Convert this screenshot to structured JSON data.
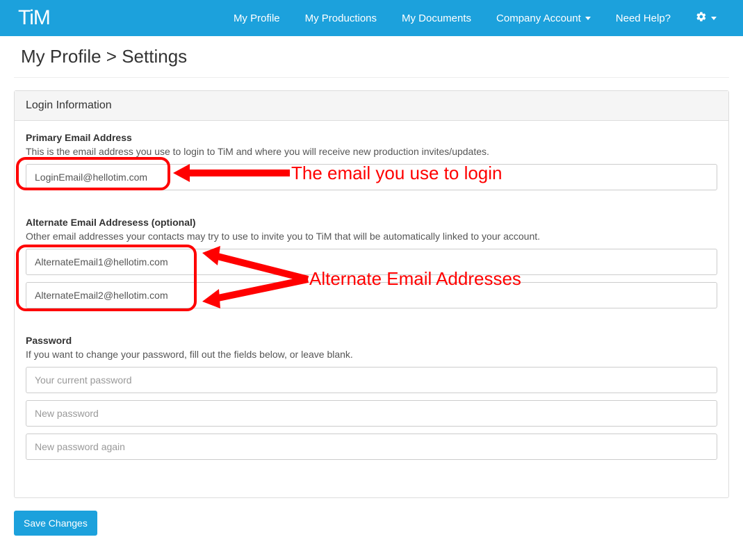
{
  "nav": {
    "logo": "TiM",
    "links": {
      "profile": "My Profile",
      "productions": "My Productions",
      "documents": "My Documents",
      "company": "Company Account",
      "help": "Need Help?"
    }
  },
  "breadcrumb": "My Profile > Settings",
  "panel": {
    "title": "Login Information",
    "primary": {
      "label": "Primary Email Address",
      "help": "This is the email address you use to login to TiM and where you will receive new production invites/updates.",
      "value": "LoginEmail@hellotim.com"
    },
    "alternate": {
      "label": "Alternate Email Addresess (optional)",
      "help": "Other email addresses your contacts may try to use to invite you to TiM that will be automatically linked to your account.",
      "value1": "AlternateEmail1@hellotim.com",
      "value2": "AlternateEmail2@hellotim.com"
    },
    "password": {
      "label": "Password",
      "help": "If you want to change your password, fill out the fields below, or leave blank.",
      "placeholder_current": "Your current password",
      "placeholder_new": "New password",
      "placeholder_again": "New password again"
    }
  },
  "buttons": {
    "save": "Save Changes"
  },
  "annotations": {
    "login": "The email you use to login",
    "alternate": "Alternate Email Addresses"
  }
}
